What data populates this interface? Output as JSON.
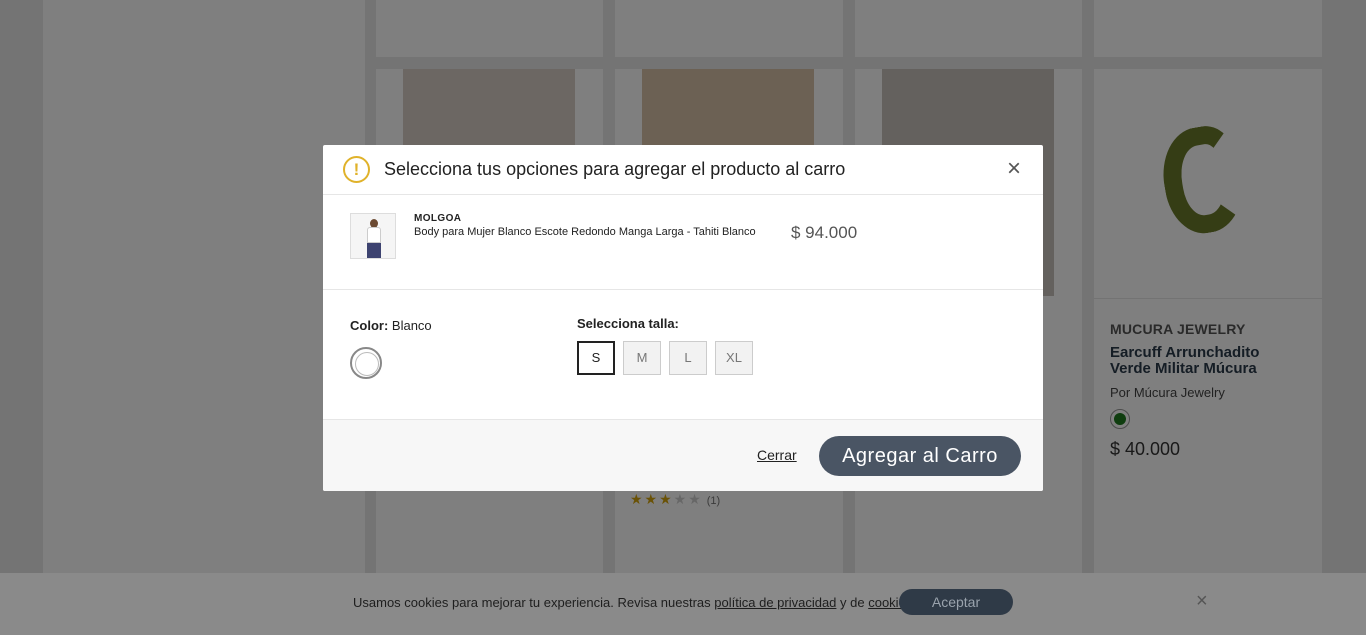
{
  "background": {
    "featured_product": {
      "brand": "MUCURA JEWELRY",
      "title": "Earcuff Arrunchadito Verde Militar Múcura",
      "by": "Por Múcura Jewelry",
      "price": "$ 40.000",
      "swatch_color": "#1e7a1e"
    },
    "rating": {
      "filled": 3,
      "total": 5,
      "count_label": "(1)"
    }
  },
  "modal": {
    "title": "Selecciona tus opciones para agregar el producto al carro",
    "warning_icon": "!",
    "close_icon": "×",
    "product": {
      "brand": "MOLGOA",
      "name": "Body para Mujer Blanco Escote Redondo Manga Larga - Tahiti Blanco",
      "price": "$ 94.000"
    },
    "color": {
      "label": "Color:",
      "value": "Blanco"
    },
    "size": {
      "label": "Selecciona talla:",
      "options": [
        "S",
        "M",
        "L",
        "XL"
      ],
      "selected": "S"
    },
    "footer": {
      "close_label": "Cerrar",
      "add_label": "Agregar al Carro"
    }
  },
  "cookie": {
    "text_before": "Usamos cookies para mejorar tu experiencia. Revisa nuestras ",
    "privacy_link": "política de privacidad",
    "text_mid": " y de ",
    "cookies_link": "cookies",
    "text_end": ".",
    "accept_label": "Aceptar",
    "close_icon": "×"
  }
}
